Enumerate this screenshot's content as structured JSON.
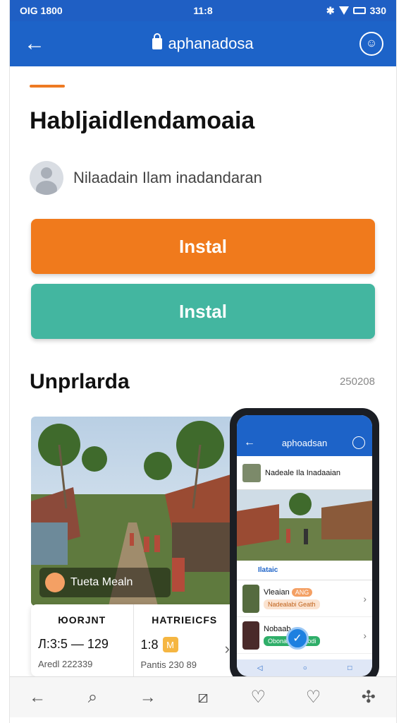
{
  "status_bar": {
    "left": "OIG 1800",
    "center": "11:8",
    "right": "330"
  },
  "app_bar": {
    "url": "aphanadosa"
  },
  "article": {
    "title": "Habljaidlendamoaia",
    "author": "Nilaadain Ilam inadandaran"
  },
  "buttons": {
    "primary": "Instal",
    "secondary": "Instal"
  },
  "section": {
    "title": "Unprlarda",
    "meta": "250208"
  },
  "screenshot": {
    "caption": "Tueta Mealn",
    "stats": [
      {
        "header": "ЮОRJNT",
        "value": "Л:3:5 — 129",
        "sub": "Aredl 222339"
      },
      {
        "header": "HATRIEICFS",
        "value": "1:8",
        "badge": "M",
        "sub": "Pantis 230 89"
      }
    ]
  },
  "phone": {
    "url": "aphoadsan",
    "header_title": "Nadeale Ila Inadaaian",
    "tab": "Ilataic",
    "items": [
      {
        "title": "Vleaian",
        "tag": "ANG",
        "chip": "Nadealabi Geath"
      },
      {
        "title": "Nobaab",
        "chip": "Obonaa ka Ayodi"
      }
    ]
  },
  "colors": {
    "app_bar": "#1d63c8",
    "primary_button": "#f07a1c",
    "secondary_button": "#43b6a0"
  },
  "icons": {
    "bottom_bar": [
      "back-arrow-icon",
      "search-icon",
      "forward-arrow-icon",
      "edit-icon",
      "heart-icon",
      "bookmark-icon",
      "extension-icon"
    ]
  }
}
